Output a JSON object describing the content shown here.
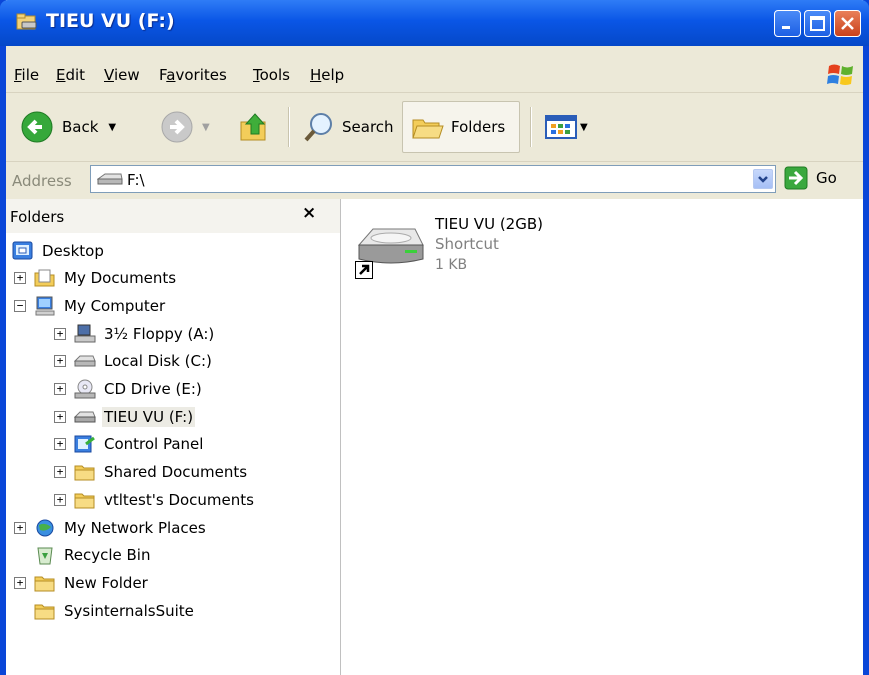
{
  "window": {
    "title": "TIEU VU (F:)"
  },
  "menu": {
    "items": [
      {
        "label": "File",
        "key": "F"
      },
      {
        "label": "Edit",
        "key": "E"
      },
      {
        "label": "View",
        "key": "V"
      },
      {
        "label": "Favorites",
        "key": "a"
      },
      {
        "label": "Tools",
        "key": "T"
      },
      {
        "label": "Help",
        "key": "H"
      }
    ]
  },
  "toolbar": {
    "back_label": "Back",
    "search_label": "Search",
    "folders_label": "Folders"
  },
  "address": {
    "label": "Address",
    "value": "F:\\",
    "go_label": "Go"
  },
  "folders_pane": {
    "title": "Folders",
    "close_glyph": "×",
    "tree": [
      {
        "label": "Desktop",
        "level": 0,
        "expander": "",
        "icon": "desktop-icon"
      },
      {
        "label": "My Documents",
        "level": 1,
        "expander": "+",
        "icon": "my-documents-icon"
      },
      {
        "label": "My Computer",
        "level": 1,
        "expander": "−",
        "icon": "my-computer-icon"
      },
      {
        "label": "3½ Floppy (A:)",
        "level": 2,
        "expander": "+",
        "icon": "floppy-drive-icon"
      },
      {
        "label": "Local Disk (C:)",
        "level": 2,
        "expander": "+",
        "icon": "hard-drive-icon"
      },
      {
        "label": "CD Drive (E:)",
        "level": 2,
        "expander": "+",
        "icon": "cd-drive-icon"
      },
      {
        "label": "TIEU VU (F:)",
        "level": 2,
        "expander": "+",
        "icon": "removable-drive-icon",
        "selected": true
      },
      {
        "label": "Control Panel",
        "level": 2,
        "expander": "+",
        "icon": "control-panel-icon"
      },
      {
        "label": "Shared Documents",
        "level": 2,
        "expander": "+",
        "icon": "folder-icon"
      },
      {
        "label": "vtltest's Documents",
        "level": 2,
        "expander": "+",
        "icon": "folder-icon"
      },
      {
        "label": "My Network Places",
        "level": 1,
        "expander": "+",
        "icon": "network-places-icon"
      },
      {
        "label": "Recycle Bin",
        "level": 1,
        "expander": "",
        "icon": "recycle-bin-icon"
      },
      {
        "label": "New Folder",
        "level": 1,
        "expander": "+",
        "icon": "folder-icon"
      },
      {
        "label": "SysinternalsSuite",
        "level": 1,
        "expander": "",
        "icon": "folder-icon"
      }
    ]
  },
  "files": [
    {
      "name": "TIEU VU (2GB)",
      "type": "Shortcut",
      "size": "1 KB",
      "icon": "drive-shortcut-icon"
    }
  ],
  "colors": {
    "titlebar": "#0a56e6",
    "window_border": "#0a46d8",
    "chrome": "#ece9d8",
    "selected_item": "#ecebe4"
  }
}
